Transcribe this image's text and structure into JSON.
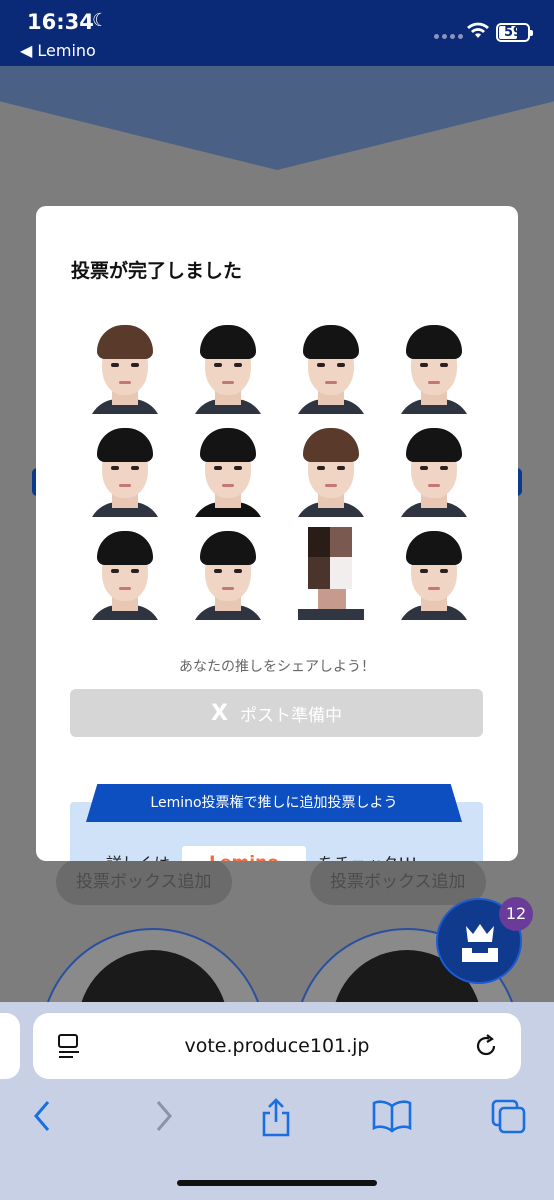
{
  "status_bar": {
    "time": "16:34",
    "back_app": "◀ Lemino",
    "battery": "59"
  },
  "background": {
    "add_box_label": "投票ボックス追加",
    "fab_badge": "12"
  },
  "modal": {
    "title": "投票が完了しました",
    "share_prompt": "あなたの推しをシェアしよう！",
    "post_button": "ポスト準備中",
    "post_icon": "X",
    "lemino_banner": "Lemino投票権で推しに追加投票しよう",
    "lemino_detail_prefix": "詳しくは",
    "lemino_logo": "Lemino",
    "lemino_detail_suffix": "をチェック!!!"
  },
  "browser": {
    "url": "vote.produce101.jp"
  },
  "colors": {
    "brand_navy": "#0a2a78",
    "accent_blue": "#0d4fc0",
    "badge_purple": "#6a3b99"
  }
}
